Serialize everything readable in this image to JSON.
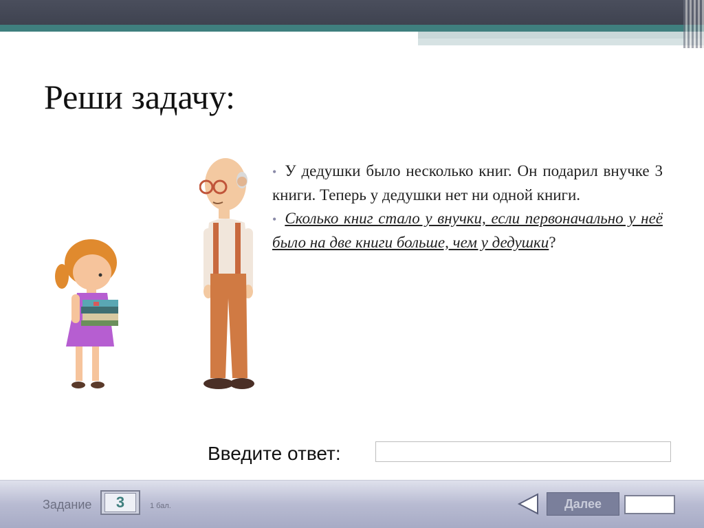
{
  "slide": {
    "title": "Реши задачу:",
    "bullets": [
      "У дедушки было несколько книг. Он подарил внучке 3 книги. Теперь у дедушки нет ни одной книги.",
      "Сколько книг стало у внучки, если первоначально у неё было на две книги больше, чем у дедушки"
    ],
    "question_mark": "?",
    "bullet_symbol": "•"
  },
  "answer": {
    "label": "Введите ответ:",
    "value": ""
  },
  "footer": {
    "task_label": "Задание",
    "task_number": "3",
    "score": "1 бал.",
    "next_label": "Далее",
    "prev_icon": "triangle-left-icon"
  },
  "colors": {
    "topbar": "#43475a",
    "teal": "#3f7f7e",
    "footer": "#b8bbd2",
    "accent": "#3f7f7e"
  }
}
